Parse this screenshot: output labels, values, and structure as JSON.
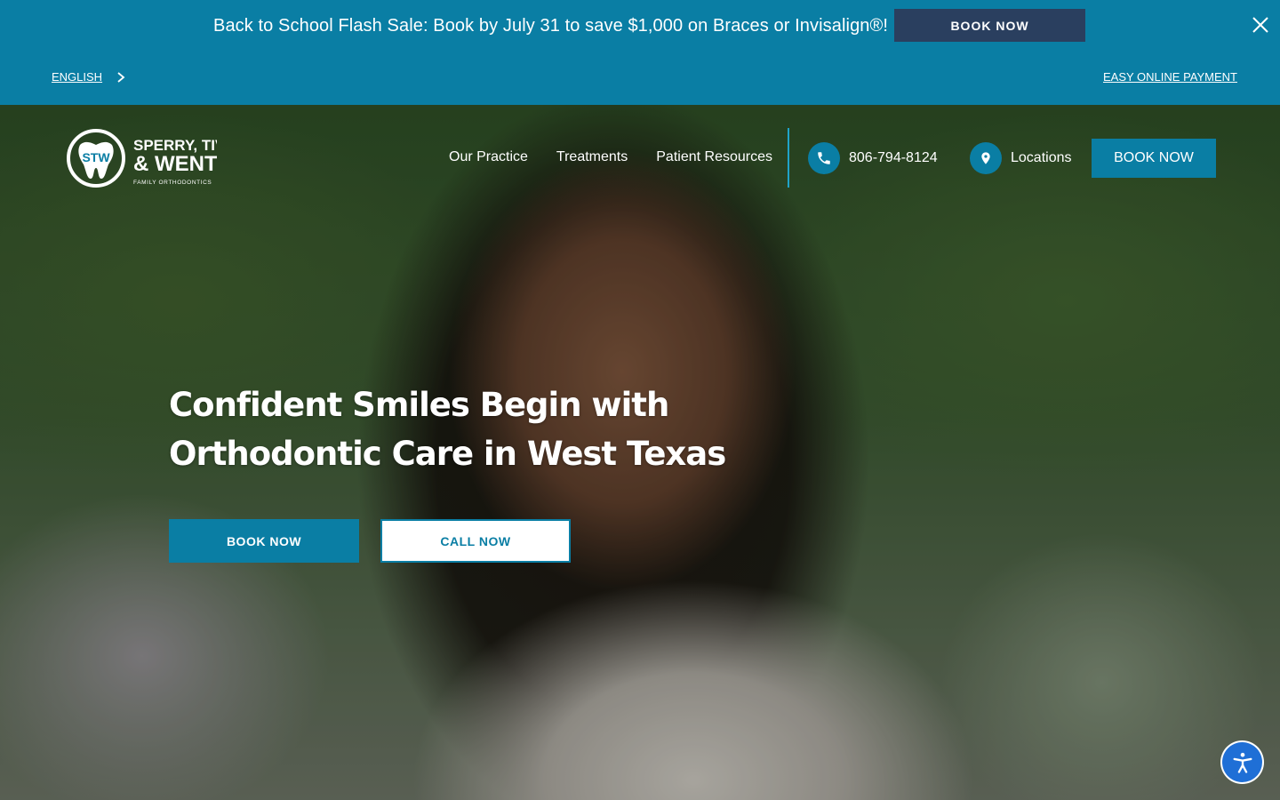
{
  "promo": {
    "text": "Back to School Flash Sale: Book by July 31 to save $1,000 on Braces or Invisalign®!",
    "button_label": "BOOK NOW"
  },
  "utility": {
    "language": "ENGLISH",
    "payment_link": "EASY ONLINE PAYMENT"
  },
  "logo": {
    "monogram": "STW",
    "line1": "SPERRY, TIVIS",
    "line2": "& WENTZ",
    "tagline": "FAMILY ORTHODONTICS"
  },
  "nav": {
    "items": [
      {
        "label": "Our Practice"
      },
      {
        "label": "Treatments"
      },
      {
        "label": "Patient Resources"
      }
    ],
    "phone": "806-794-8124",
    "locations": "Locations",
    "book_label": "BOOK NOW"
  },
  "hero": {
    "headline": "Confident Smiles Begin with Orthodontic Care in West Texas",
    "cta_book": "BOOK NOW",
    "cta_call": "CALL NOW"
  },
  "colors": {
    "brand_blue": "#0a7ea4",
    "promo_button": "#2a3f5f",
    "accessibility_blue": "#1f6fd6"
  },
  "icons": [
    "close-icon",
    "chevron-right-icon",
    "phone-icon",
    "location-pin-icon",
    "accessibility-icon",
    "tooth-logo-icon"
  ]
}
